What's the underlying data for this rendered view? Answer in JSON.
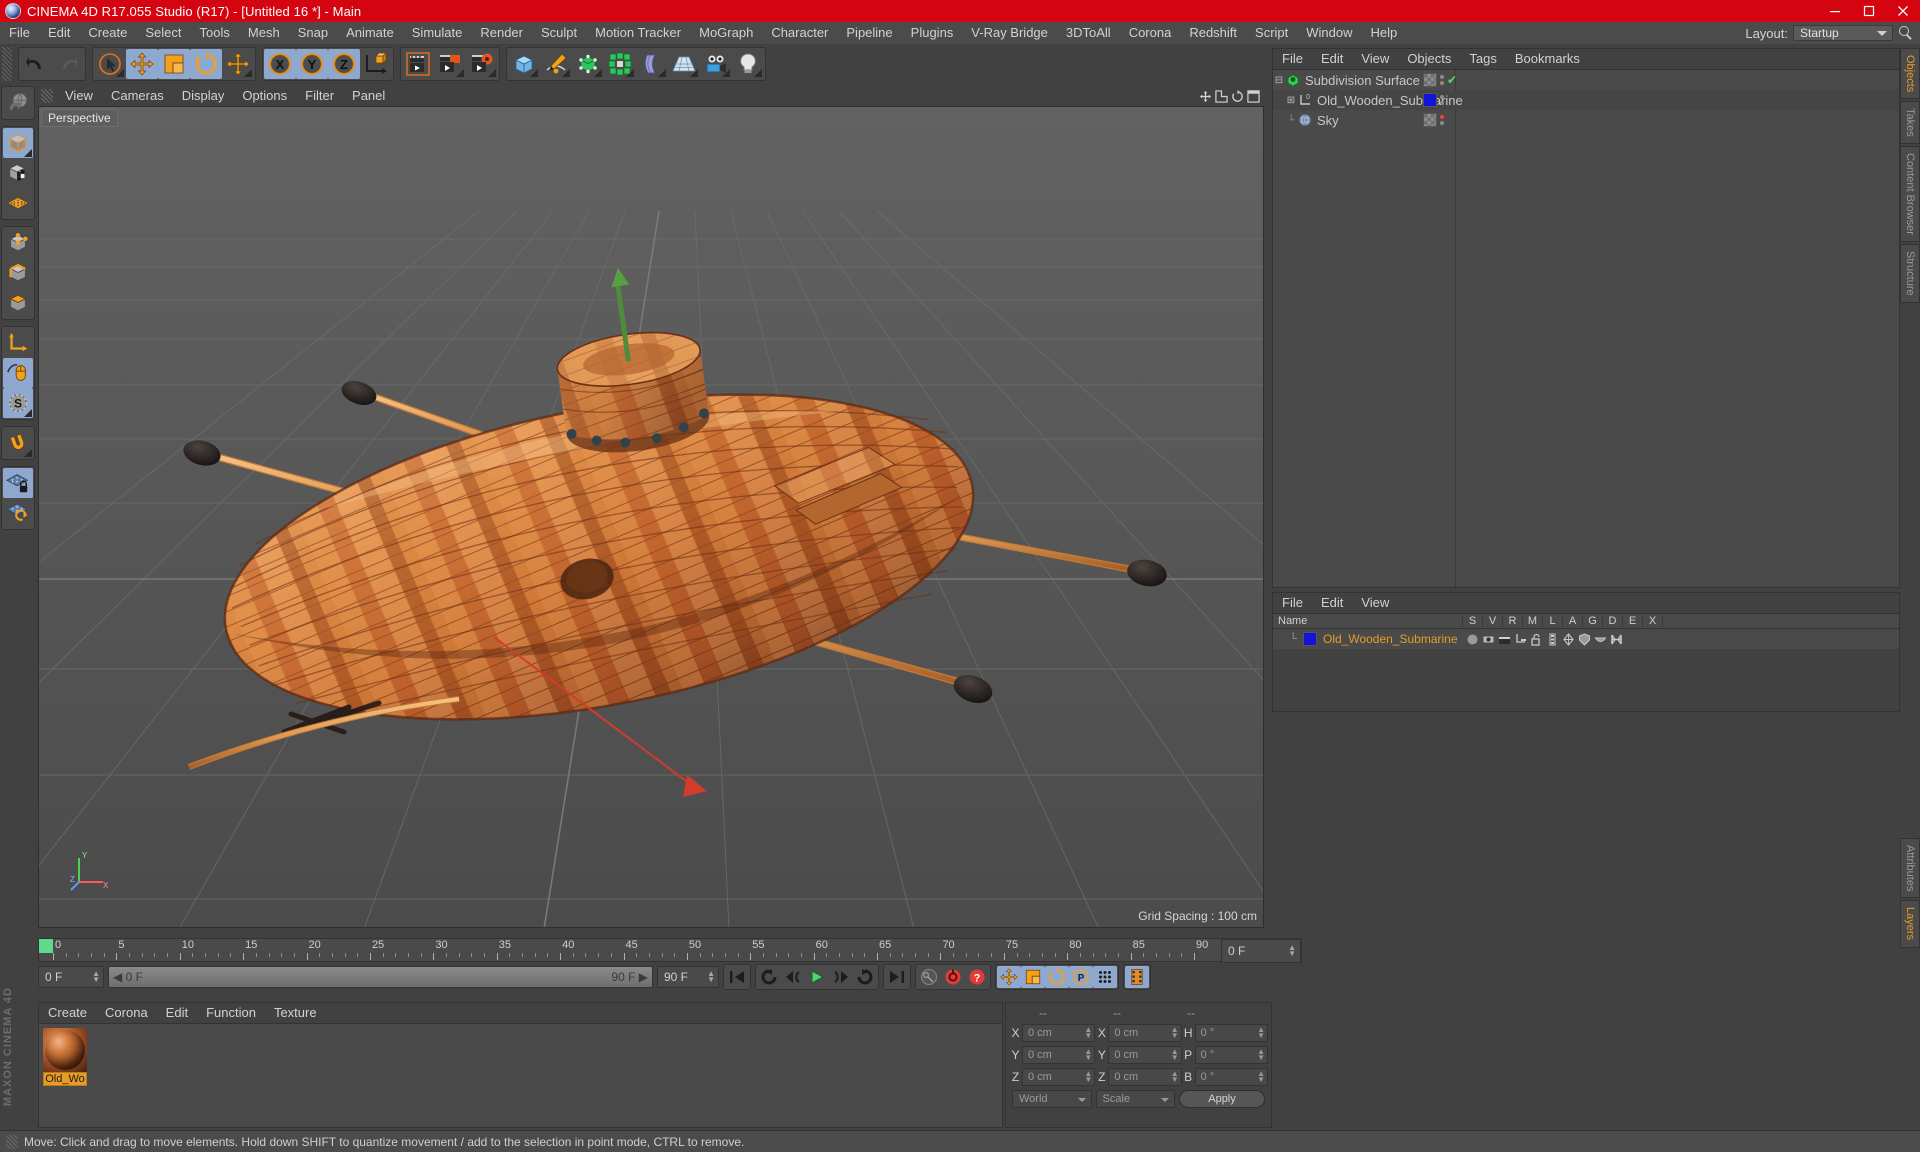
{
  "window": {
    "title": "CINEMA 4D R17.055 Studio (R17) - [Untitled 16 *] - Main",
    "app_icon": "c4d-logo-icon",
    "minimize": "minimize-icon",
    "maximize": "maximize-icon",
    "close": "close-icon",
    "titlebar_color": "#d40511"
  },
  "menubar": {
    "items": [
      {
        "label": "File"
      },
      {
        "label": "Edit"
      },
      {
        "label": "Create"
      },
      {
        "label": "Select"
      },
      {
        "label": "Tools"
      },
      {
        "label": "Mesh"
      },
      {
        "label": "Snap"
      },
      {
        "label": "Animate"
      },
      {
        "label": "Simulate"
      },
      {
        "label": "Render"
      },
      {
        "label": "Sculpt"
      },
      {
        "label": "Motion Tracker"
      },
      {
        "label": "MoGraph"
      },
      {
        "label": "Character"
      },
      {
        "label": "Pipeline"
      },
      {
        "label": "Plugins"
      },
      {
        "label": "V-Ray Bridge"
      },
      {
        "label": "3DToAll"
      },
      {
        "label": "Corona"
      },
      {
        "label": "Redshift"
      },
      {
        "label": "Script"
      },
      {
        "label": "Window"
      },
      {
        "label": "Help"
      }
    ],
    "layout_label": "Layout:",
    "layout_value": "Startup",
    "search_icon": "search-icon"
  },
  "toolbar": {
    "groups": [
      {
        "buttons": [
          {
            "name": "undo-button",
            "icon": "undo-arrow-icon",
            "selected": false
          },
          {
            "name": "redo-button",
            "icon": "redo-arrow-icon",
            "selected": false
          }
        ]
      },
      {
        "buttons": [
          {
            "name": "live-selection-button",
            "icon": "cursor-select-icon",
            "selected": false,
            "sub": true
          },
          {
            "name": "move-tool-button",
            "icon": "move-arrows-icon",
            "selected": true
          },
          {
            "name": "scale-tool-button",
            "icon": "scale-box-icon",
            "selected": true
          },
          {
            "name": "rotate-tool-button",
            "icon": "rotate-circle-icon",
            "selected": true
          },
          {
            "name": "move-duplicate-button",
            "icon": "move-arrows-icon",
            "selected": false,
            "sub": true
          }
        ]
      },
      {
        "buttons": [
          {
            "name": "axis-x-button",
            "icon": "x-axis-icon",
            "selected": true
          },
          {
            "name": "axis-y-button",
            "icon": "y-axis-icon",
            "selected": true
          },
          {
            "name": "axis-z-button",
            "icon": "z-axis-icon",
            "selected": true
          },
          {
            "name": "world-coordinate-button",
            "icon": "world-axis-cube-icon",
            "selected": false
          }
        ]
      },
      {
        "buttons": [
          {
            "name": "render-view-button",
            "icon": "render-clapper-icon",
            "selected": false
          },
          {
            "name": "render-region-button",
            "icon": "render-region-icon",
            "selected": false,
            "sub": true
          },
          {
            "name": "render-settings-button",
            "icon": "render-gear-icon",
            "selected": false,
            "sub": true
          }
        ]
      },
      {
        "buttons": [
          {
            "name": "primitive-cube-button",
            "icon": "cube-icon",
            "selected": false,
            "sub": true
          },
          {
            "name": "spline-pen-button",
            "icon": "pen-spline-icon",
            "selected": false,
            "sub": true
          },
          {
            "name": "generator-button",
            "icon": "green-cube-generator-icon",
            "selected": false,
            "sub": true
          },
          {
            "name": "array-button",
            "icon": "green-cluster-icon",
            "selected": false,
            "sub": true
          },
          {
            "name": "deformer-button",
            "icon": "bend-deformer-icon",
            "selected": false,
            "sub": true
          },
          {
            "name": "scene-floor-button",
            "icon": "floor-grid-icon",
            "selected": false,
            "sub": true
          },
          {
            "name": "camera-button",
            "icon": "camera-icon",
            "selected": false,
            "sub": true
          },
          {
            "name": "light-button",
            "icon": "light-bulb-icon",
            "selected": false,
            "sub": true
          }
        ]
      }
    ]
  },
  "left_toolbar": {
    "groups": [
      {
        "buttons": [
          {
            "name": "undo-view-button",
            "icon": "globe-undo-icon",
            "selected": false
          }
        ]
      },
      {
        "buttons": [
          {
            "name": "model-mode-button",
            "icon": "model-cube-icon",
            "selected": true,
            "sub": true
          },
          {
            "name": "texture-mode-button",
            "icon": "texture-checker-cube-icon",
            "selected": false
          },
          {
            "name": "workplane-mode-button",
            "icon": "orange-grid-plane-icon",
            "selected": false
          }
        ]
      },
      {
        "buttons": [
          {
            "name": "point-mode-button",
            "icon": "point-cube-icon",
            "selected": false
          },
          {
            "name": "edge-mode-button",
            "icon": "edge-cube-icon",
            "selected": false
          },
          {
            "name": "polygon-mode-button",
            "icon": "polygon-cube-icon",
            "selected": false
          }
        ]
      },
      {
        "buttons": [
          {
            "name": "object-axis-button",
            "icon": "axis-l-icon",
            "selected": false
          },
          {
            "name": "viewport-solo-button",
            "icon": "mouse-icon",
            "selected": true
          },
          {
            "name": "selection-mode-button",
            "icon": "s-circle-icon",
            "selected": true,
            "sub": true
          }
        ]
      },
      {
        "buttons": [
          {
            "name": "magnet-button",
            "icon": "magnet-icon",
            "selected": false,
            "sub": true
          }
        ]
      },
      {
        "buttons": [
          {
            "name": "lock-workplane-button",
            "icon": "grid-lock-icon",
            "selected": true
          },
          {
            "name": "workplane-toggle-button",
            "icon": "grid-orange-icon",
            "selected": false
          }
        ]
      }
    ],
    "brand": "MAXON CINEMA 4D"
  },
  "viewport": {
    "menu": [
      {
        "label": "View"
      },
      {
        "label": "Cameras"
      },
      {
        "label": "Display"
      },
      {
        "label": "Options"
      },
      {
        "label": "Filter"
      },
      {
        "label": "Panel"
      }
    ],
    "label": "Perspective",
    "grid_spacing": "Grid Spacing : 100 cm",
    "axis_gizmo": {
      "y": "Y",
      "x": "X",
      "z": "Z"
    },
    "icons": [
      {
        "name": "viewport-move-icon"
      },
      {
        "name": "viewport-scale-icon"
      },
      {
        "name": "viewport-rotate-icon"
      },
      {
        "name": "viewport-maximize-icon"
      }
    ],
    "scene_object": "Old_Wooden_Submarine"
  },
  "timeline": {
    "ticks": [
      "0",
      "5",
      "10",
      "15",
      "20",
      "25",
      "30",
      "35",
      "40",
      "45",
      "50",
      "55",
      "60",
      "65",
      "70",
      "75",
      "80",
      "85",
      "90"
    ],
    "current_frame_box": "0 F",
    "current_frame_field": "0 F",
    "scroll_left": "0 F",
    "scroll_right": "90 F",
    "preview_end": "90 F",
    "end_frame": "90 F",
    "transport": [
      {
        "name": "go-to-start-button",
        "icon": "skip-start-icon"
      },
      {
        "name": "play-backward-loop-button",
        "icon": "loop-back-icon"
      },
      {
        "name": "step-back-button",
        "icon": "prev-frame-icon"
      },
      {
        "name": "play-button",
        "icon": "play-icon"
      },
      {
        "name": "step-forward-button",
        "icon": "next-frame-icon"
      },
      {
        "name": "loop-forward-button",
        "icon": "loop-forward-icon"
      },
      {
        "name": "go-to-end-button",
        "icon": "skip-end-icon"
      }
    ],
    "record_group": [
      {
        "name": "autokey-button",
        "icon": "key-icon",
        "selected": false
      },
      {
        "name": "record-active-objects-button",
        "icon": "record-red-icon",
        "selected": false
      },
      {
        "name": "keyframe-selection-button",
        "icon": "question-red-icon",
        "selected": false
      }
    ],
    "animate_group": [
      {
        "name": "position-key-button",
        "icon": "move-arrows-icon",
        "selected": true
      },
      {
        "name": "scale-key-button",
        "icon": "scale-box-icon",
        "selected": true
      },
      {
        "name": "rotation-key-button",
        "icon": "rotate-circle-icon",
        "selected": true
      },
      {
        "name": "param-key-button",
        "icon": "p-circle-icon",
        "selected": true
      },
      {
        "name": "pla-key-button",
        "icon": "point-grid-icon",
        "selected": true
      }
    ],
    "timeline_button": {
      "name": "timeline-button",
      "icon": "film-strip-icon",
      "selected": true
    }
  },
  "material_manager": {
    "menu": [
      {
        "label": "Create"
      },
      {
        "label": "Corona"
      },
      {
        "label": "Edit"
      },
      {
        "label": "Function"
      },
      {
        "label": "Texture"
      }
    ],
    "materials": [
      {
        "name": "Old_Wo",
        "full_name": "Old_Wooden_Submarine",
        "selected": true,
        "swatch": "wood-sphere-preview"
      }
    ]
  },
  "coordinates": {
    "headers": [
      "--",
      "--",
      "--"
    ],
    "rows": [
      {
        "axis1": "X",
        "v1": "0 cm",
        "axis2": "X",
        "v2": "0 cm",
        "axis3": "H",
        "v3": "0 °"
      },
      {
        "axis1": "Y",
        "v1": "0 cm",
        "axis2": "Y",
        "v2": "0 cm",
        "axis3": "P",
        "v3": "0 °"
      },
      {
        "axis1": "Z",
        "v1": "0 cm",
        "axis2": "Z",
        "v2": "0 cm",
        "axis3": "B",
        "v3": "0 °"
      }
    ],
    "system": "World",
    "mode": "Scale",
    "apply": "Apply"
  },
  "object_manager": {
    "menu": [
      {
        "label": "File"
      },
      {
        "label": "Edit"
      },
      {
        "label": "View"
      },
      {
        "label": "Objects"
      },
      {
        "label": "Tags"
      },
      {
        "label": "Bookmarks"
      }
    ],
    "rows": [
      {
        "name": "Subdivision Surface",
        "icon": "subdivision-surface-icon",
        "depth": 0,
        "expander": "minus",
        "tag": "checker",
        "marker": "green-check"
      },
      {
        "name": "Old_Wooden_Submarine",
        "icon": "null-object-icon",
        "depth": 1,
        "expander": "plus",
        "tag": "blue",
        "marker": "none"
      },
      {
        "name": "Sky",
        "icon": "sky-sphere-icon",
        "depth": 1,
        "expander": "none",
        "tag": "checker",
        "marker": "red-dot"
      }
    ]
  },
  "object_list": {
    "menu": [
      {
        "label": "File"
      },
      {
        "label": "Edit"
      },
      {
        "label": "View"
      }
    ],
    "columns": [
      "Name",
      "S",
      "V",
      "R",
      "M",
      "L",
      "A",
      "G",
      "D",
      "E",
      "X"
    ],
    "rows": [
      {
        "name": "Old_Wooden_Submarine",
        "swatch": "#1414d8",
        "tags": [
          "sphere-gray-icon",
          "visibility-icon",
          "render-clapper-icon",
          "connect-icon",
          "unlock-icon",
          "layer-icon",
          "axis-icon",
          "shield-icon",
          "cap-icon",
          "bone-icon"
        ]
      }
    ]
  },
  "right_tabs": {
    "top": [
      {
        "label": "Objects",
        "active": true
      },
      {
        "label": "Takes",
        "active": false
      },
      {
        "label": "Content Browser",
        "active": false
      },
      {
        "label": "Structure",
        "active": false
      }
    ],
    "bottom": [
      {
        "label": "Attributes",
        "active": false
      },
      {
        "label": "Layers",
        "active": true
      }
    ]
  },
  "statusbar": {
    "text": "Move: Click and drag to move elements. Hold down SHIFT to quantize movement / add to the selection in point mode, CTRL to remove."
  },
  "colors": {
    "accent_orange": "#e79c27",
    "selection_blue": "#8ea8cf",
    "title_red": "#d40511",
    "panel_bg": "#414141",
    "field_bg": "#4a4a4a"
  }
}
